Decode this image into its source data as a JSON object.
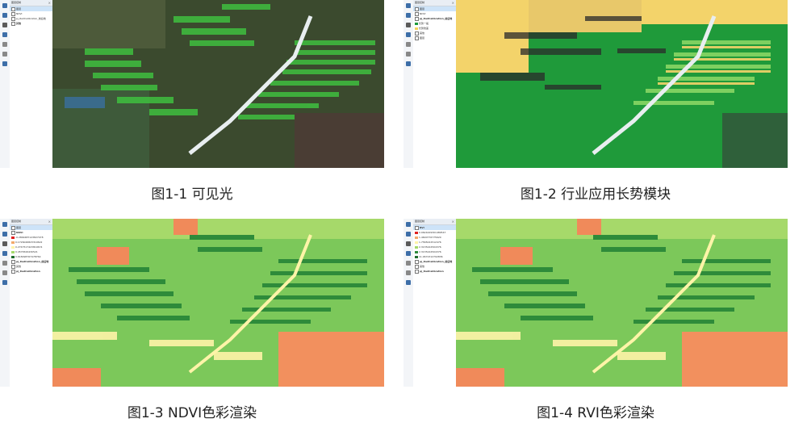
{
  "panels": [
    {
      "caption": "图1-1 可见光",
      "layer_title": "图层控制",
      "layers": [
        "图层",
        "NDVI",
        "pj_RadCalibration_前后地",
        "其他"
      ],
      "style": "rgb"
    },
    {
      "caption": "图1-2 行业应用长势模块",
      "layer_title": "图层控制",
      "layers": [
        "图层",
        "NDVI",
        "pj_RadCalibration_前后地",
        "长势一般",
        "长势较差",
        "其他",
        "图层"
      ],
      "style": "class"
    },
    {
      "caption": "图1-3 NDVI色彩渲染",
      "layer_title": "图层控制",
      "layers": [
        "图层",
        "NDVI",
        "-0.2899487123827478",
        "0.1726046823310622",
        "0.2747517423819674",
        "0.4578326430521",
        "0.618498767478764",
        "pj_RadCalibration_前后地",
        "其他",
        "pj_RadCalibration"
      ],
      "style": "ndvi"
    },
    {
      "caption": "图1-4 RVI色彩渲染",
      "layer_title": "图层控制",
      "layers": [
        "RVI",
        "0.0624449301489547",
        "1.4600776775620",
        "1.7565022512476",
        "2.3135242504376",
        "2.3135242504376",
        "11.0672312792836",
        "pj_RadCalibration_前后地",
        "其他",
        "pj_RadCalibration"
      ],
      "style": "ndvi"
    }
  ],
  "swatch_colors": {
    "rgb": [
      "#888888",
      "#4caf50",
      "#cccccc",
      "#aaaaaa"
    ],
    "class": [
      "#ffffff",
      "#e02020",
      "#f5d25a",
      "#1b9a3c",
      "#7bd35b",
      "#cccccc",
      "#ffffff"
    ],
    "ndvi": [
      "#ffffff",
      "#e8532d",
      "#f2a96a",
      "#fff4a8",
      "#a4d96a",
      "#2e8b3a",
      "#1e6b2b",
      "#ffffff",
      "#ffffff",
      "#ffffff"
    ]
  }
}
